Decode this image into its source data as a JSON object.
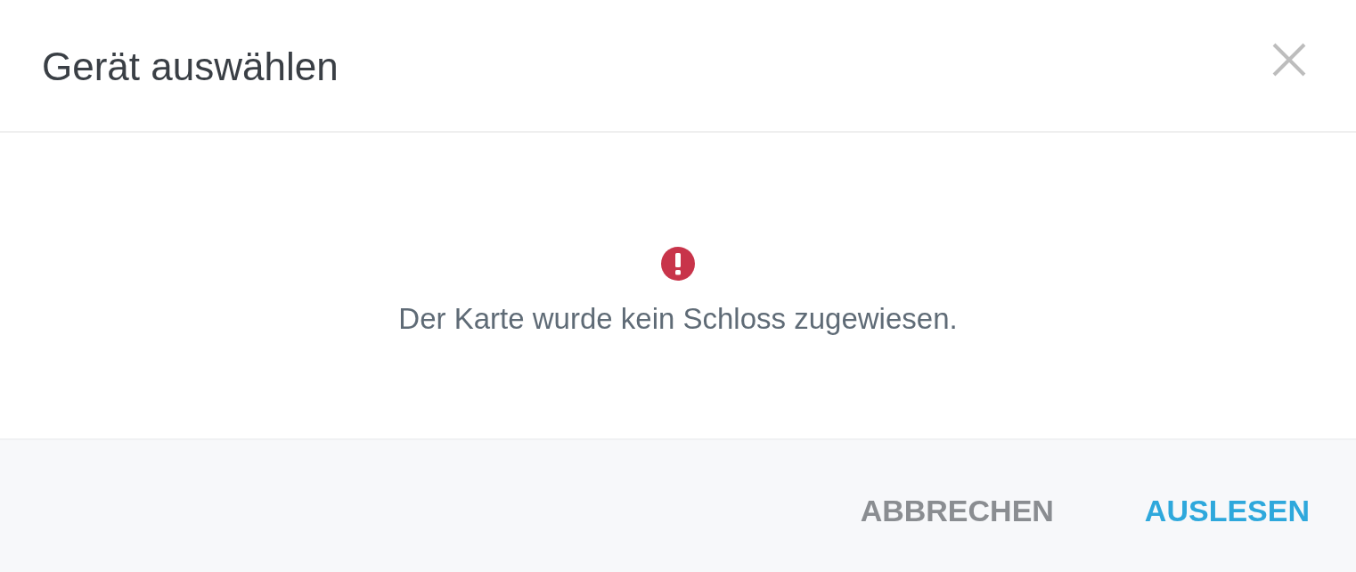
{
  "dialog": {
    "title": "Gerät auswählen"
  },
  "message": {
    "kind": "error",
    "text": "Der Karte wurde kein Schloss zugewiesen."
  },
  "buttons": [
    {
      "label": "ABBRECHEN",
      "kind": "secondary"
    },
    {
      "label": "AUSLESEN",
      "kind": "primary"
    }
  ]
}
